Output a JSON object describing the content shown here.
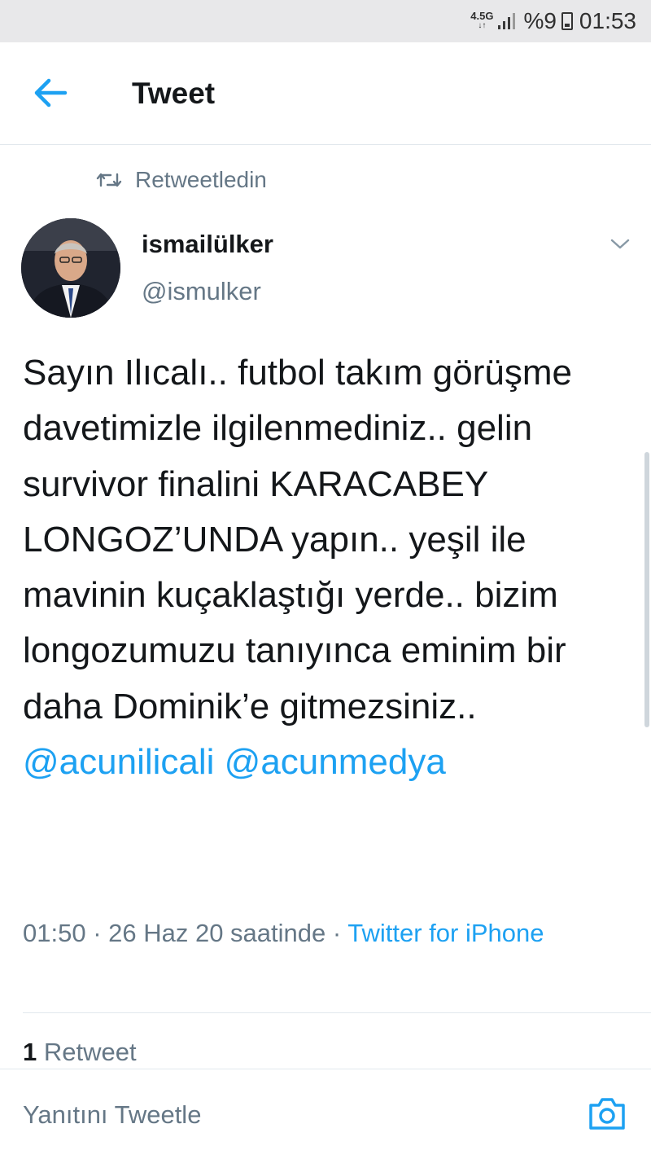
{
  "status_bar": {
    "network": "4.5G",
    "battery": "%9",
    "time": "01:53"
  },
  "header": {
    "title": "Tweet"
  },
  "retweet_context": {
    "label": "Retweetledin"
  },
  "tweet": {
    "author_name": "ismailülker",
    "author_handle": "@ismulker",
    "text": "Sayın Ilıcalı.. futbol takım görüşme davetimizle ilgilenmediniz.. gelin survivor finalini KARACABEY LONGOZ’UNDA yapın.. yeşil ile mavinin kuçaklaştığı yerde.. bizim longozumuzu tanıyınca eminim bir daha Dominik’e gitmezsiniz..",
    "mention_1": "@acunilicali",
    "mention_2": "@acunmedya",
    "timestamp": "01:50 · 26 Haz 20 saatinde · ",
    "source": "Twitter for iPhone",
    "retweet_count": "1",
    "retweet_label": "Retweet"
  },
  "reply": {
    "placeholder": "Yanıtını Tweetle"
  },
  "colors": {
    "accent": "#1da1f2",
    "secondary_text": "#657786",
    "divider": "#e1e8ed"
  },
  "icons": {
    "back": "arrow-left-icon",
    "retweet": "retweet-icon",
    "caret": "chevron-down-icon",
    "camera": "camera-icon"
  }
}
